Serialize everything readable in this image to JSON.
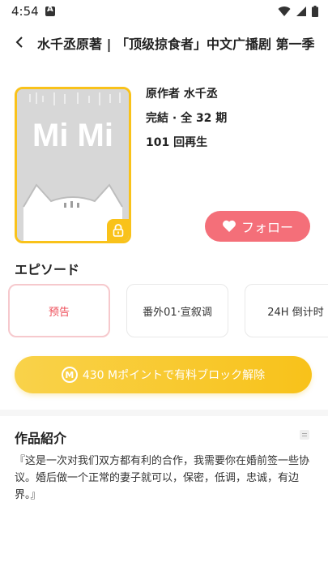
{
  "status_bar": {
    "time": "4:54"
  },
  "header": {
    "title": "水千丞原著 | 「顶级掠食者」中文广播剧 第一季"
  },
  "cover": {
    "logo_text": "Mi Mi"
  },
  "info": {
    "author": "原作者 水千丞",
    "episodes": "完結 · 全 32 期",
    "plays": "101 回再生"
  },
  "follow_button": {
    "label": "フォロー"
  },
  "episodes_section": {
    "title": "エピソード",
    "items": [
      {
        "label": "预告",
        "active": true
      },
      {
        "label": "番外01·宣叙调",
        "active": false
      },
      {
        "label": "24H 倒计时",
        "active": false
      }
    ]
  },
  "unlock_button": {
    "label": "430 Mポイントで有料ブロック解除",
    "coin_symbol": "M"
  },
  "intro": {
    "title": "作品紹介",
    "text": "『这是一次对我们双方都有利的合作，我需要你在婚前签一些协议。婚后做一个正常的妻子就可以，保密，低调，忠诚，有边界。』"
  },
  "colors": {
    "accent_yellow": "#f9c21a",
    "follow_pink": "#f46f79",
    "active_red": "#ee4b57"
  }
}
